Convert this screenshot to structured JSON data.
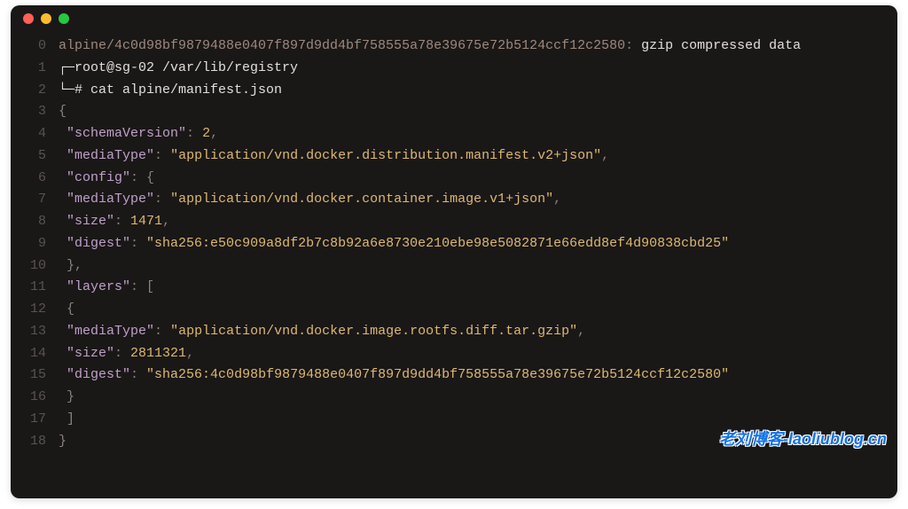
{
  "window": {
    "dot_red": "red",
    "dot_yellow": "yellow",
    "dot_green": "green"
  },
  "lines": {
    "l0a": "alpine/4c0d98bf9879488e0407f897d9dd4bf758555a78e39675e72b5124ccf12c2580",
    "l0b": ": ",
    "l0c": "gzip compressed data",
    "l1_prefix": "┌─",
    "l1_prompt": "root@sg-02 /var/lib/registry",
    "l2_prefix": "└─",
    "l2_cmd": "# cat alpine/manifest.json",
    "l3": "{",
    "l4_k": "\"schemaVersion\"",
    "l4_v": "2",
    "l5_k": "\"mediaType\"",
    "l5_v": "\"application/vnd.docker.distribution.manifest.v2+json\"",
    "l6_k": "\"config\"",
    "l6_v": "{",
    "l7_k": "\"mediaType\"",
    "l7_v": "\"application/vnd.docker.container.image.v1+json\"",
    "l8_k": "\"size\"",
    "l8_v": "1471",
    "l9_k": "\"digest\"",
    "l9_v": "\"sha256:e50c909a8df2b7c8b92a6e8730e210ebe98e5082871e66edd8ef4d90838cbd25\"",
    "l10": "},",
    "l11_k": "\"layers\"",
    "l11_v": "[",
    "l12": "{",
    "l13_k": "\"mediaType\"",
    "l13_v": "\"application/vnd.docker.image.rootfs.diff.tar.gzip\"",
    "l14_k": "\"size\"",
    "l14_v": "2811321",
    "l15_k": "\"digest\"",
    "l15_v": "\"sha256:4c0d98bf9879488e0407f897d9dd4bf758555a78e39675e72b5124ccf12c2580\"",
    "l16": "}",
    "l17": "]",
    "l18": "}"
  },
  "lineno": {
    "n0": "0",
    "n1": "1",
    "n2": "2",
    "n3": "3",
    "n4": "4",
    "n5": "5",
    "n6": "6",
    "n7": "7",
    "n8": "8",
    "n9": "9",
    "n10": "10",
    "n11": "11",
    "n12": "12",
    "n13": "13",
    "n14": "14",
    "n15": "15",
    "n16": "16",
    "n17": "17",
    "n18": "18"
  },
  "punct": {
    "colon": ": ",
    "comma": ",",
    "space": " "
  },
  "watermark": "老刘博客-laoliublog.cn"
}
